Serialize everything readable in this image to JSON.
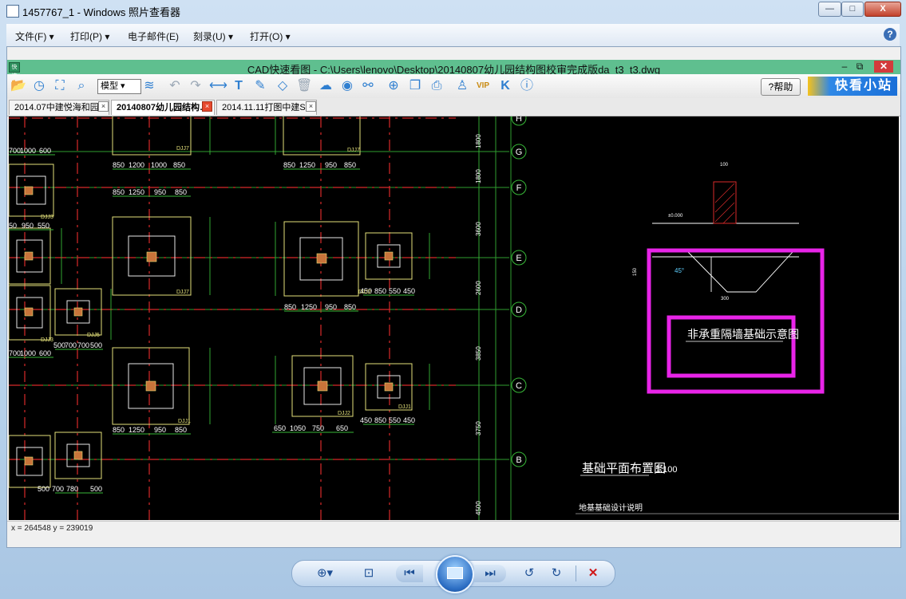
{
  "window": {
    "title": "1457767_1 - Windows 照片查看器",
    "minimize": "—",
    "maximize": "□",
    "close": "X"
  },
  "menu": {
    "items": [
      "文件(F) ▾",
      "打印(P) ▾",
      "电子邮件(E)",
      "刻录(U) ▾",
      "打开(O) ▾"
    ],
    "help": "?"
  },
  "cad": {
    "app_icon": "快速",
    "title": "CAD快速看图 - C:\\Users\\lenovo\\Desktop\\20140807幼儿园结构图校审完成版da_t3_t3.dwg",
    "win_minimize": "–",
    "win_restore": "⧉",
    "win_close": "✕",
    "toolbar": {
      "model_select": "模型 ▾",
      "help_button": "?帮助",
      "logo": "快看小站"
    },
    "tabs": [
      {
        "label": "2014.07中建悦海和园…",
        "active": false
      },
      {
        "label": "20140807幼儿园结构…",
        "active": true
      },
      {
        "label": "2014.11.11打图中建S…",
        "active": false
      }
    ],
    "tab_close": "×",
    "status": {
      "coords": "x = 264548  y = 239019"
    }
  },
  "drawing": {
    "axis_labels": [
      "H",
      "G",
      "F",
      "E",
      "D",
      "C",
      "B"
    ],
    "foundation_labels": [
      "DJJ7",
      "DJJ7",
      "DJJ7",
      "DJJ3",
      "DJJ5",
      "DJJ3",
      "DJJ2",
      "DJJ1",
      "DJJ2",
      "DJJ1"
    ],
    "dimensions_row1": [
      "850",
      "1200",
      "1000",
      "850"
    ],
    "dimensions_row2": [
      "850",
      "1250",
      "950",
      "850"
    ],
    "dimensions_row3": [
      "850",
      "1250",
      "950",
      "850"
    ],
    "dimensions_row4": [
      "850",
      "1250",
      "950",
      "850"
    ],
    "dimensions_row5": [
      "650",
      "1050",
      "750",
      "650"
    ],
    "dimensions_left1": [
      "700",
      "1000",
      "600"
    ],
    "dimensions_left2": [
      "50",
      "950",
      "550"
    ],
    "dimensions_left3": [
      "500",
      "700",
      "700",
      "500"
    ],
    "dimensions_left4": [
      "700",
      "1000",
      "600"
    ],
    "dimensions_left5": [
      "500",
      "700",
      "780",
      "500"
    ],
    "dimensions_small1": [
      "450",
      "850",
      "550",
      "450"
    ],
    "dimensions_small2": [
      "450",
      "850",
      "550",
      "450"
    ],
    "spacings": [
      "1800",
      "1800",
      "3600",
      "2600",
      "3850",
      "3750",
      "4500"
    ],
    "section_dims": {
      "top": "100",
      "left": "150",
      "bottom": "300",
      "level": "±0.000",
      "angle": "45°"
    },
    "section_title": "非承重隔墙基础示意图",
    "plan_title": "基础平面布置图",
    "plan_scale": "1:100",
    "notes_title": "地基基础设计说明"
  }
}
